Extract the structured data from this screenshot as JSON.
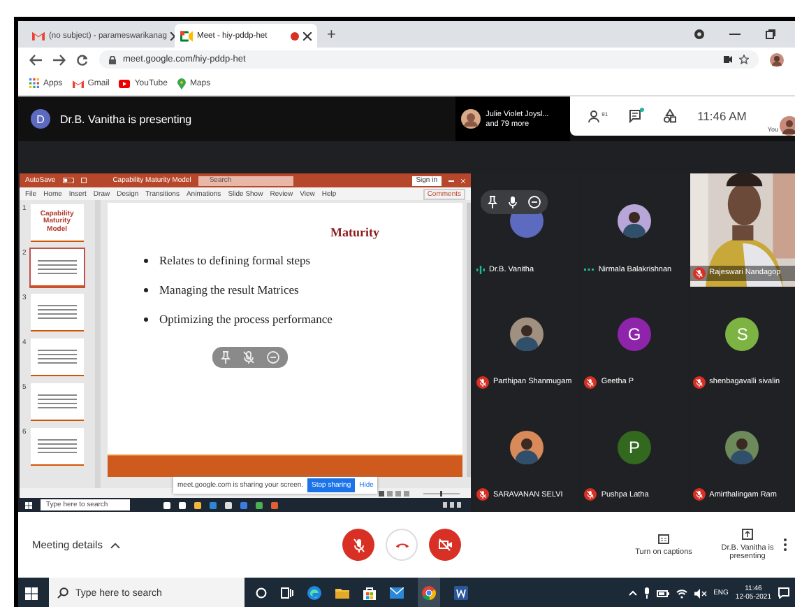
{
  "browser": {
    "tabs": [
      {
        "title": "(no subject) - parameswarikanag",
        "kind": "gmail",
        "selected": false,
        "recording": false
      },
      {
        "title": "Meet - hiy-pddp-het",
        "kind": "meet",
        "selected": true,
        "recording": true
      }
    ],
    "new_tab": "+",
    "url": "meet.google.com/hiy-pddp-het",
    "bookmarks": [
      {
        "label": "Apps",
        "kind": "apps"
      },
      {
        "label": "Gmail",
        "kind": "gmail"
      },
      {
        "label": "YouTube",
        "kind": "youtube"
      },
      {
        "label": "Maps",
        "kind": "maps"
      }
    ]
  },
  "meet_header": {
    "presenter_initial": "D",
    "presenting_text": "Dr.B. Vanitha is presenting",
    "viewer_name": "Julie Violet Joysl...",
    "viewer_more": "and 79 more",
    "people_count": "91",
    "chat_unread": true,
    "time": "11:46 AM",
    "self_label": "You"
  },
  "presentation": {
    "autosave": "AutoSave",
    "doc_title": "Capability Maturity Model",
    "search": "Search",
    "sign_in": "Sign in",
    "menu": [
      "File",
      "Home",
      "Insert",
      "Draw",
      "Design",
      "Transitions",
      "Animations",
      "Slide Show",
      "Review",
      "View",
      "Help"
    ],
    "comments": "Comments",
    "thumbnails": [
      {
        "number": "1",
        "title": "Capability Maturity Model",
        "selected": false
      },
      {
        "number": "2",
        "selected": true
      },
      {
        "number": "3",
        "selected": false
      },
      {
        "number": "4",
        "selected": false
      },
      {
        "number": "5",
        "selected": false
      },
      {
        "number": "6",
        "selected": false
      }
    ],
    "slide": {
      "title": "Maturity",
      "bullets": [
        "Relates to defining formal steps",
        "Managing the result Matrices",
        "Optimizing the process performance"
      ]
    },
    "share_notice": "meet.google.com is sharing your screen.",
    "stop_sharing": "Stop sharing",
    "hide": "Hide",
    "taskbar_search": "Type here to search"
  },
  "participants": [
    {
      "name": "Dr.B. Vanitha",
      "kind": "letter",
      "color": "#5c6bc0",
      "muted": false,
      "speaking": true,
      "hovered": true
    },
    {
      "name": "Nirmala Balakrishnan",
      "muted": false,
      "speaking": false,
      "hovered": false
    },
    {
      "name": "Rajeswari Nandagop",
      "kind": "video",
      "muted": true,
      "hovered": false
    },
    {
      "name": "Parthipan Shanmugam",
      "muted": true,
      "hovered": false
    },
    {
      "name": "Geetha P",
      "kind": "letter",
      "letter": "G",
      "color": "#8e24aa",
      "muted": true,
      "hovered": false
    },
    {
      "name": "shenbagavalli sivalin",
      "kind": "letter",
      "letter": "S",
      "color": "#7cb342",
      "muted": true,
      "hovered": false
    },
    {
      "name": "SARAVANAN SELVI",
      "muted": true,
      "hovered": false
    },
    {
      "name": "Pushpa Latha",
      "kind": "letter",
      "letter": "P",
      "color": "#33691e",
      "muted": true,
      "hovered": false
    },
    {
      "name": "Amirthalingam Ram",
      "muted": true,
      "hovered": false
    }
  ],
  "bottom_bar": {
    "meeting_details": "Meeting details",
    "mic_on": false,
    "camera_on": false,
    "captions": "Turn on captions",
    "presenting": "Dr.B. Vanitha is presenting"
  },
  "taskbar": {
    "search": "Type here to search",
    "language": "ENG",
    "time": "11:46",
    "date": "12-05-2021"
  }
}
